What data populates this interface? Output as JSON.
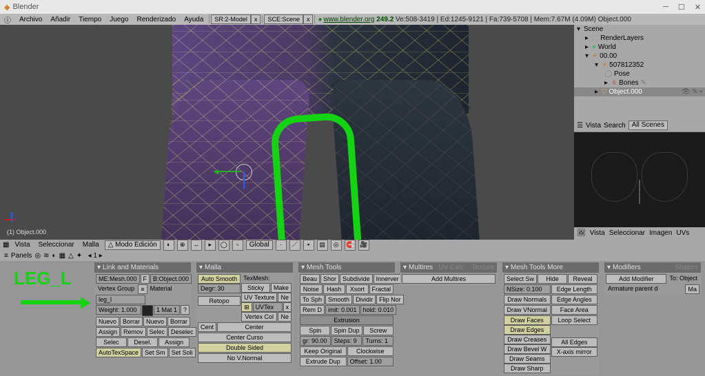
{
  "title": "Blender",
  "menubar": {
    "items": [
      "Archivo",
      "Añadir",
      "Tiempo",
      "Juego",
      "Renderizado",
      "Ayuda"
    ],
    "screen": "SR:2-Model",
    "scene": "SCE:Scene",
    "url": "www.blender.org",
    "version": "249.2",
    "stats": "Ve:508-3419 | Ed:1245-9121 | Fa:739-5708 | Mem:7.67M (4.09M) Object.000"
  },
  "outliner": {
    "root": "Scene",
    "items": [
      "RenderLayers",
      "World",
      "00.00",
      "507812352",
      "Pose",
      "Bones",
      "Object.000"
    ],
    "header": {
      "view": "Vista",
      "search": "Search",
      "scope": "All Scenes"
    }
  },
  "previewHeader": {
    "vista": "Vista",
    "seleccionar": "Seleccionar",
    "imagen": "Imagen",
    "uvs": "UVs"
  },
  "view3d": {
    "info": "(1) Object.000",
    "header": {
      "vista": "Vista",
      "seleccionar": "Seleccionar",
      "malla": "Malla",
      "mode": "Modo Edición",
      "orient": "Global"
    }
  },
  "panelsHeader": {
    "label": "Panels",
    "page": "1"
  },
  "annotation": {
    "label": "LEG_L"
  },
  "panels": {
    "link": {
      "title": "Link and Materials",
      "me": "ME:Mesh.000",
      "f": "F",
      "ob": "B:Object.000",
      "vg": "Vertex Group",
      "mat": "Material",
      "group": "leg_l",
      "weight": "Weight: 1.000",
      "matslot": "1 Mat 1",
      "q": "?",
      "nuevo": "Nuevo",
      "borrar": "Borrar",
      "assign": "Assign",
      "remov": "Remov",
      "selec": "Selec",
      "deselec": "Deselec",
      "desel": "Desel.",
      "autotex": "AutoTexSpace",
      "setsm": "Set Sm",
      "setsoli": "Set Soli"
    },
    "malla": {
      "title": "Malla",
      "autosmooth": "Auto Smooth",
      "degr": "Degr: 30",
      "retopo": "Retopo",
      "texmesh": "TexMesh:",
      "sticky": "Sticky",
      "make": "Make",
      "uvtex": "UV Texture",
      "ne1": "Ne",
      "uvtex2": "UVTex",
      "vcol": "Vertex Col",
      "ne2": "Ne",
      "centc": "Cent",
      "center": "Center",
      "ccurso": "Center Curso",
      "dsided": "Double Sided",
      "novn": "No V.Normal"
    },
    "mtools": {
      "title": "Mesh Tools",
      "r1": [
        "Beau",
        "Shor",
        "Subdivide",
        "Innerver"
      ],
      "r2": [
        "Noise",
        "Hash",
        "Xsort",
        "Fractal"
      ],
      "r3": [
        "To Sph",
        "Smooth",
        "Dividir",
        "Flip Nor"
      ],
      "r4": [
        "Rem D",
        "imit: 0.001",
        "hold: 0.010"
      ],
      "extrusion": "Extrusion",
      "r5": [
        "Spin",
        "Spin Dup",
        "Screw"
      ],
      "r6": [
        "gr: 90.00",
        "Steps: 9",
        "Turns: 1"
      ],
      "r7": [
        "Keep Original",
        "Clockwise"
      ],
      "r8": [
        "Extrude Dup",
        "Offset: 1.00"
      ]
    },
    "multires": {
      "title": "Multires",
      "uvcalc": "UV Calc",
      "texture": "Texture",
      "add": "Add Multires"
    },
    "mtmore": {
      "title": "Mesh Tools More",
      "selsw": "Select Sw",
      "hide": "Hide",
      "reveal": "Reveal",
      "nsize": "NSize: 0.100",
      "elen": "Edge Length",
      "dnorm": "Draw Normals",
      "eang": "Edge Angles",
      "dvn": "Draw VNormal",
      "farea": "Face Area",
      "dfaces": "Draw Faces",
      "loop": "Loop Select",
      "dedges": "Draw Edges",
      "dcreases": "Draw Creases",
      "dbevel": "Draw Bevel W",
      "dseams": "Draw Seams",
      "dsharp": "Draw Sharp",
      "alledges": "All Edges",
      "xmirror": "X-axis mirror"
    },
    "modifiers": {
      "title": "Modifiers",
      "shapes": "Shapes",
      "addmod": "Add Modifier",
      "to": "To: Object",
      "arm": "Armature parent d",
      "ma": "Ma"
    }
  }
}
